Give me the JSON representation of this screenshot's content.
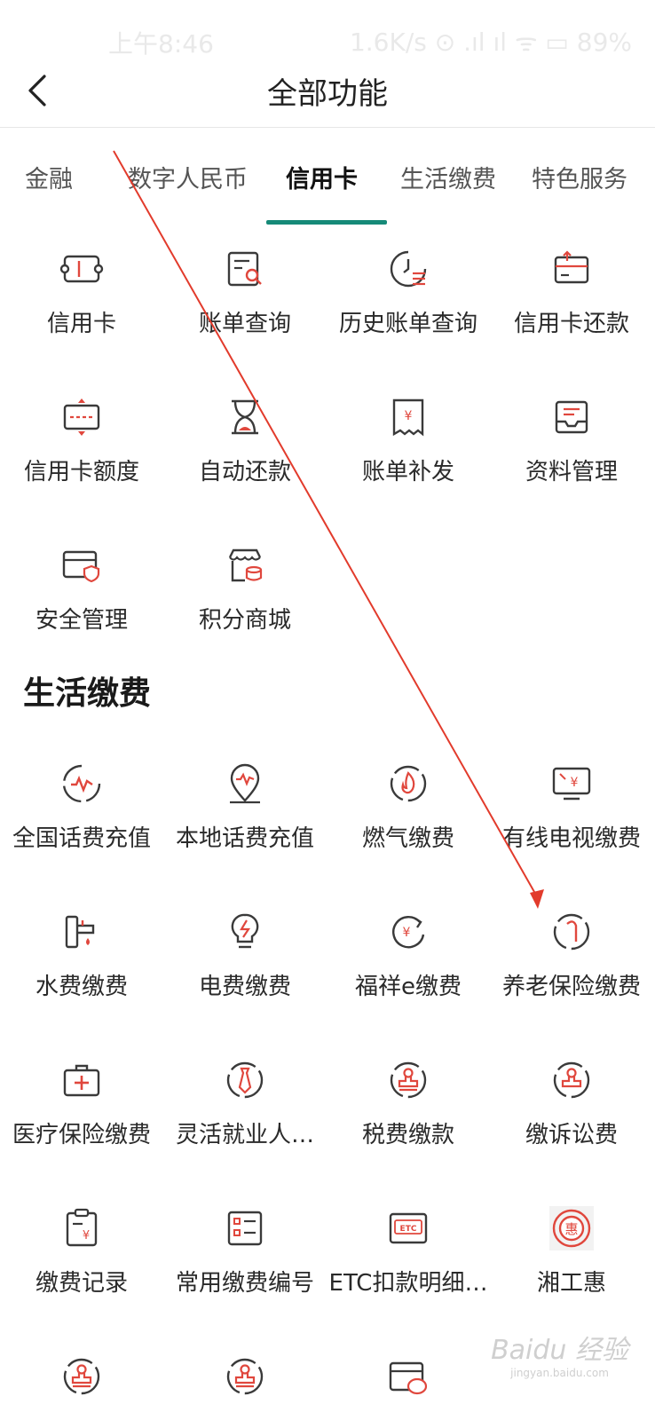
{
  "status_bar": {
    "time": "上午8:46",
    "right": "1.6K/s ⊙ .ıl ıl ᯤ ▭ 89%"
  },
  "header": {
    "title": "全部功能"
  },
  "tabs": [
    {
      "label": "金融"
    },
    {
      "label": "数字人民币"
    },
    {
      "label": "信用卡"
    },
    {
      "label": "生活缴费"
    },
    {
      "label": "特色服务"
    }
  ],
  "active_tab": "信用卡",
  "credit_card": {
    "items": [
      {
        "label": "信用卡",
        "icon": "card-ticket-icon"
      },
      {
        "label": "账单查询",
        "icon": "bill-search-icon"
      },
      {
        "label": "历史账单查询",
        "icon": "history-clock-icon"
      },
      {
        "label": "信用卡还款",
        "icon": "card-repay-icon"
      },
      {
        "label": "信用卡额度",
        "icon": "card-limit-icon"
      },
      {
        "label": "自动还款",
        "icon": "hourglass-icon"
      },
      {
        "label": "账单补发",
        "icon": "bill-yuan-icon"
      },
      {
        "label": "资料管理",
        "icon": "inbox-tray-icon"
      },
      {
        "label": "安全管理",
        "icon": "card-shield-icon"
      },
      {
        "label": "积分商城",
        "icon": "store-coins-icon"
      }
    ]
  },
  "life_payment": {
    "title": "生活缴费",
    "items": [
      {
        "label": "全国话费充值",
        "icon": "phone-wave-icon"
      },
      {
        "label": "本地话费充值",
        "icon": "location-wave-icon"
      },
      {
        "label": "燃气缴费",
        "icon": "flame-icon"
      },
      {
        "label": "有线电视缴费",
        "icon": "tv-yuan-icon"
      },
      {
        "label": "水费缴费",
        "icon": "water-tap-icon"
      },
      {
        "label": "电费缴费",
        "icon": "bulb-icon"
      },
      {
        "label": "福祥e缴费",
        "icon": "yuan-refresh-icon"
      },
      {
        "label": "养老保险缴费",
        "icon": "cane-icon"
      },
      {
        "label": "医疗保险缴费",
        "icon": "medical-kit-icon"
      },
      {
        "label": "灵活就业人…",
        "icon": "tie-icon"
      },
      {
        "label": "税费缴款",
        "icon": "stamp-icon"
      },
      {
        "label": "缴诉讼费",
        "icon": "gavel-stamp-icon"
      },
      {
        "label": "缴费记录",
        "icon": "clipboard-yuan-icon"
      },
      {
        "label": "常用缴费编号",
        "icon": "list-card-icon"
      },
      {
        "label": "ETC扣款明细…",
        "icon": "etc-icon"
      },
      {
        "label": "湘工惠",
        "icon": "hui-badge-icon"
      },
      {
        "label": "",
        "icon": "stamp-icon"
      },
      {
        "label": "",
        "icon": "stamp-icon"
      },
      {
        "label": "",
        "icon": "card-logo-icon"
      }
    ]
  },
  "watermark": {
    "text": "Bai du 经验",
    "sub": "jingyan.baidu.com"
  },
  "colors": {
    "accent": "#168a78",
    "icon_red": "#e0473d",
    "icon_dark": "#3a3a3a",
    "arrow": "#e23b2c"
  }
}
